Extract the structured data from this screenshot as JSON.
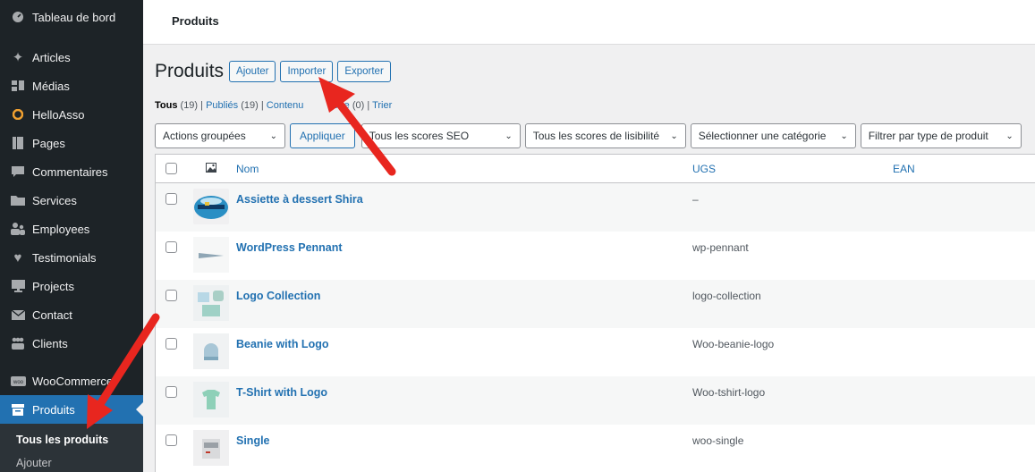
{
  "sidebar": {
    "items": [
      {
        "label": "Tableau de bord",
        "icon": "dashboard-icon"
      },
      {
        "label": "Articles",
        "icon": "pin-icon"
      },
      {
        "label": "Médias",
        "icon": "media-icon"
      },
      {
        "label": "HelloAsso",
        "icon": "helloasso-icon"
      },
      {
        "label": "Pages",
        "icon": "page-icon"
      },
      {
        "label": "Commentaires",
        "icon": "comment-icon"
      },
      {
        "label": "Services",
        "icon": "folder-icon"
      },
      {
        "label": "Employees",
        "icon": "users-icon"
      },
      {
        "label": "Testimonials",
        "icon": "heart-icon"
      },
      {
        "label": "Projects",
        "icon": "portfolio-icon"
      },
      {
        "label": "Contact",
        "icon": "email-icon"
      },
      {
        "label": "Clients",
        "icon": "groups-icon"
      },
      {
        "label": "WooCommerce",
        "icon": "woo-icon"
      },
      {
        "label": "Produits",
        "icon": "archive-icon"
      }
    ],
    "submenu": [
      {
        "label": "Tous les produits"
      },
      {
        "label": "Ajouter"
      }
    ]
  },
  "topbar": {
    "title": "Produits"
  },
  "heading": {
    "title": "Produits",
    "buttons": [
      "Ajouter",
      "Importer",
      "Exporter"
    ]
  },
  "views": {
    "all": "Tous",
    "all_count": "(19)",
    "published": "Publiés",
    "published_count": "(19)",
    "draft": "Contenu",
    "draft_hidden": "one",
    "draft_count": "(0)",
    "sort": "Trier"
  },
  "filters": {
    "bulk": "Actions groupées",
    "apply": "Appliquer",
    "seo": "Tous les scores SEO",
    "readability": "Tous les scores de lisibilité",
    "category": "Sélectionner une catégorie",
    "type": "Filtrer par type de produit"
  },
  "table": {
    "columns": {
      "name": "Nom",
      "sku": "UGS",
      "ean": "EAN"
    },
    "rows": [
      {
        "name": "Assiette à dessert Shira",
        "sku": "–"
      },
      {
        "name": "WordPress Pennant",
        "sku": "wp-pennant"
      },
      {
        "name": "Logo Collection",
        "sku": "logo-collection"
      },
      {
        "name": "Beanie with Logo",
        "sku": "Woo-beanie-logo"
      },
      {
        "name": "T-Shirt with Logo",
        "sku": "Woo-tshirt-logo"
      },
      {
        "name": "Single",
        "sku": "woo-single"
      }
    ]
  },
  "colors": {
    "accent": "#2271b1",
    "sidebar": "#1d2327",
    "arrow": "#e8261f"
  }
}
